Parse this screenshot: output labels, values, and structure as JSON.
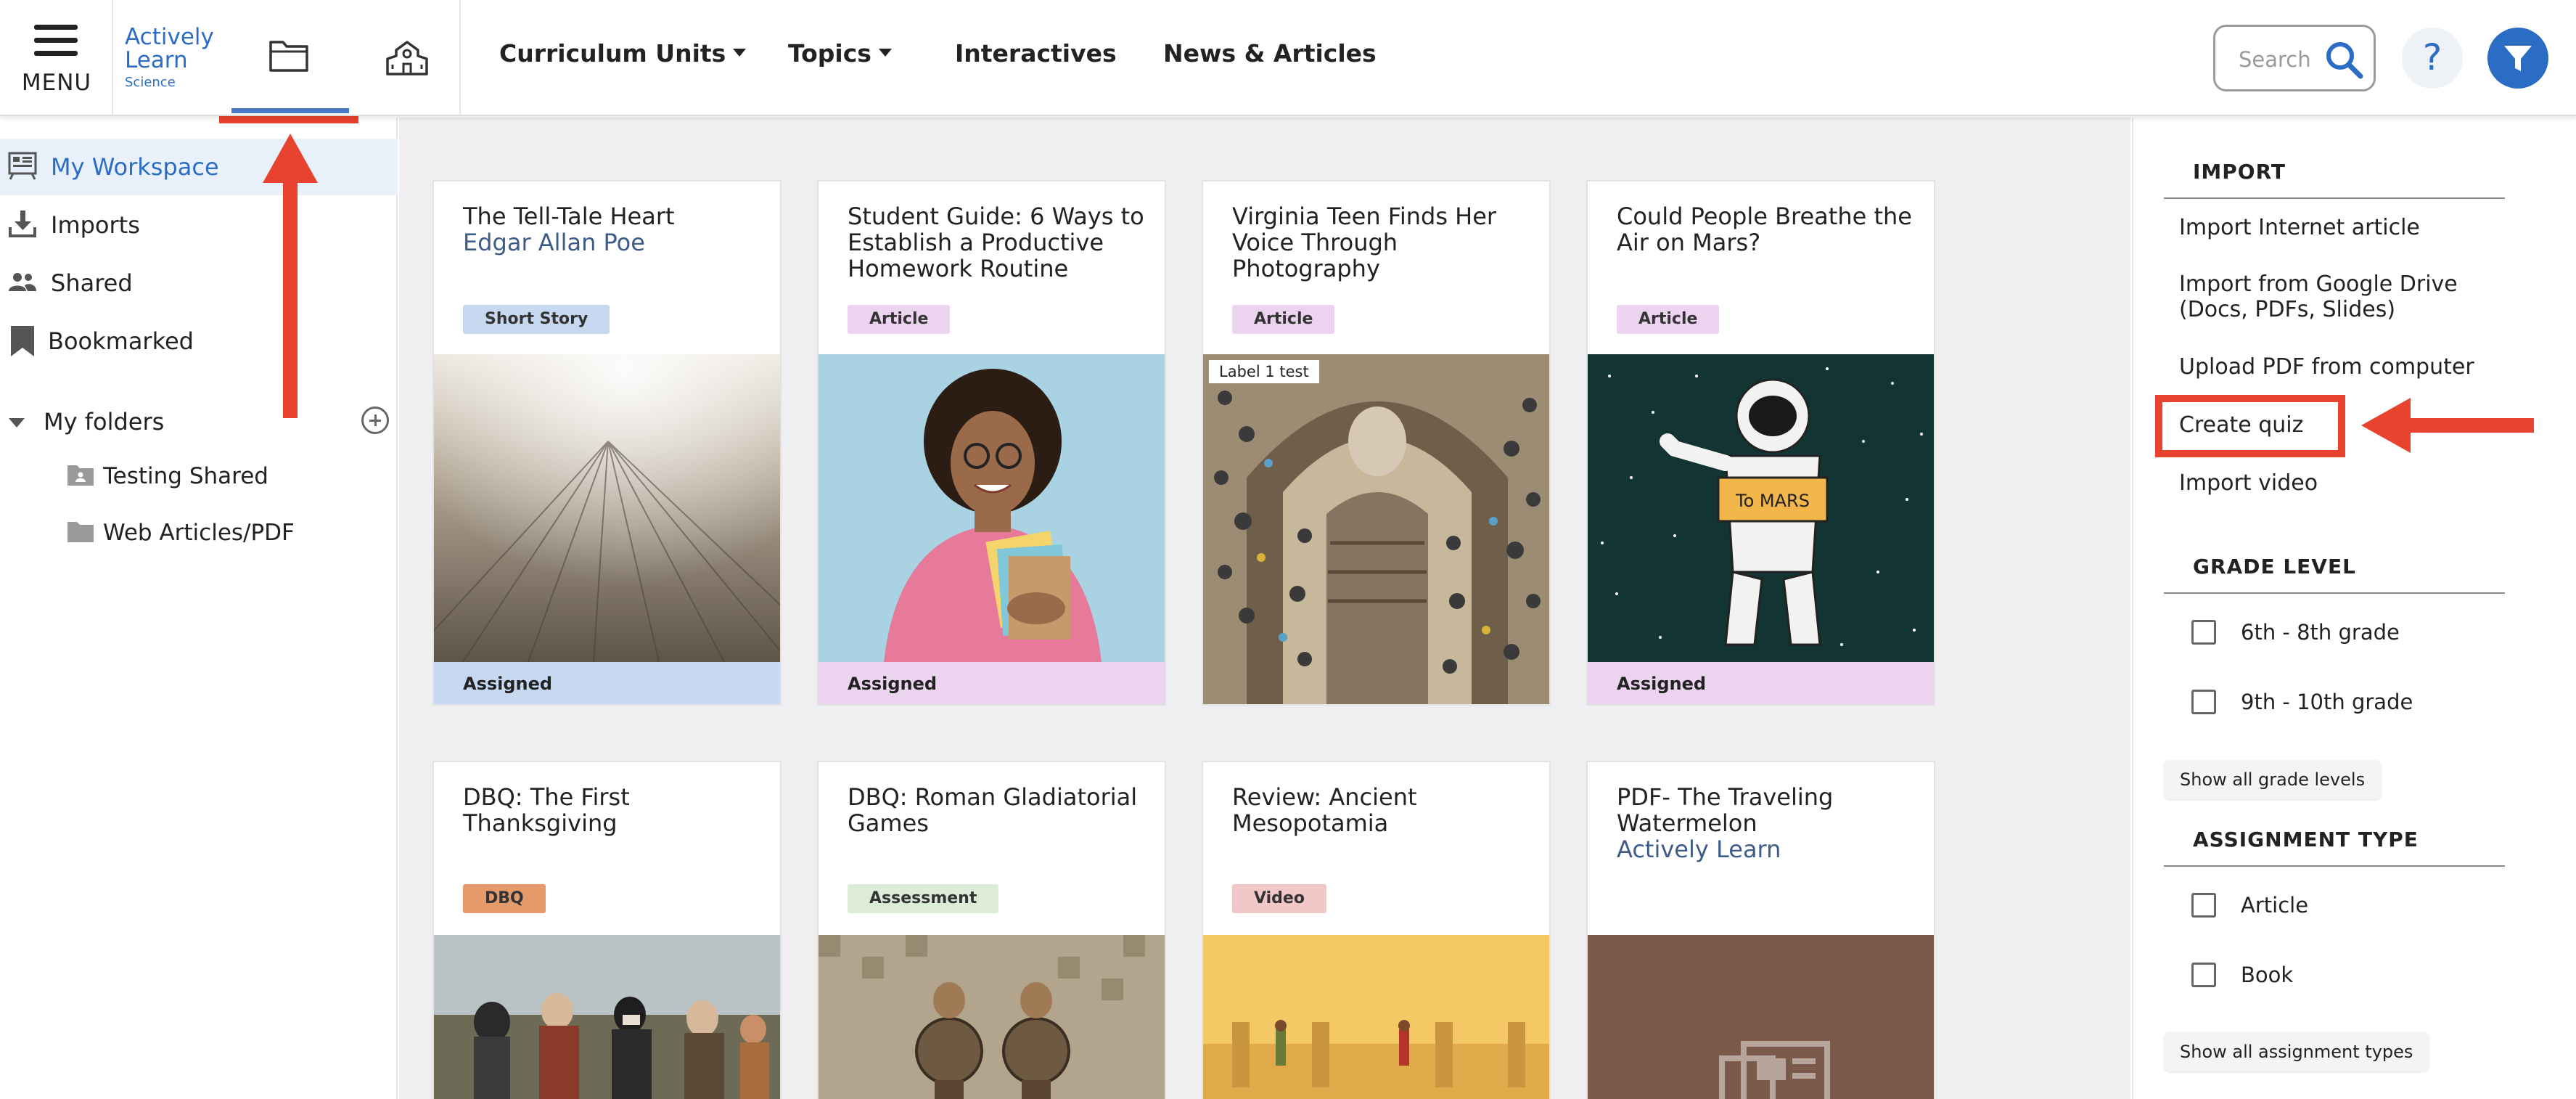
{
  "header": {
    "menu_label": "MENU",
    "logo": {
      "line1": "Actively",
      "line2": "Learn",
      "line3": "Science"
    },
    "nav": [
      {
        "label": "Curriculum Units"
      },
      {
        "label": "Topics"
      },
      {
        "label": "Interactives"
      },
      {
        "label": "News & Articles"
      }
    ],
    "search_placeholder": "Search",
    "help_label": "?"
  },
  "sidebar": {
    "items": [
      {
        "label": "My Workspace",
        "active": true
      },
      {
        "label": "Imports"
      },
      {
        "label": "Shared"
      },
      {
        "label": "Bookmarked"
      }
    ],
    "folders_label": "My folders",
    "folders": [
      {
        "label": "Testing Shared"
      },
      {
        "label": "Web Articles/PDF"
      }
    ]
  },
  "cards": [
    {
      "title": "The Tell-Tale Heart",
      "author": "Edgar Allan Poe",
      "tag": "Short Story",
      "status": "Assigned"
    },
    {
      "title": "Student Guide: 6 Ways to Establish a Productive Homework Routine",
      "author": "",
      "tag": "Article",
      "status": "Assigned"
    },
    {
      "title": "Virginia Teen Finds Her Voice Through Photography",
      "author": "",
      "tag": "Article",
      "status": "",
      "image_label": "Label 1 test"
    },
    {
      "title": "Could People Breathe the Air on Mars?",
      "author": "",
      "tag": "Article",
      "status": "Assigned",
      "image_text": "To MARS"
    },
    {
      "title": "DBQ: The First Thanksgiving",
      "author": "",
      "tag": "DBQ",
      "status": ""
    },
    {
      "title": "DBQ: Roman Gladiatorial Games",
      "author": "",
      "tag": "Assessment",
      "status": ""
    },
    {
      "title": "Review: Ancient Mesopotamia",
      "author": "",
      "tag": "Video",
      "status": ""
    },
    {
      "title": "PDF- The Traveling Watermelon",
      "author": "Actively Learn",
      "tag": "",
      "status": ""
    }
  ],
  "right_panel": {
    "import_heading": "IMPORT",
    "import_links": [
      "Import Internet article",
      "Import from Google Drive (Docs, PDFs, Slides)",
      "Upload PDF from computer",
      "Create quiz",
      "Import video"
    ],
    "grade_heading": "GRADE LEVEL",
    "grades": [
      "6th - 8th grade",
      "9th - 10th grade"
    ],
    "show_grades": "Show all grade levels",
    "assignment_heading": "ASSIGNMENT TYPE",
    "assignment_types": [
      "Article",
      "Book"
    ],
    "show_assignment_types": "Show all assignment types"
  },
  "colors": {
    "accent": "#2b6cc4",
    "annotation": "#e8432f",
    "tag_short_story": "#c6d9f1",
    "tag_article": "#ecd3ef",
    "tag_dbq": "#e49a6b",
    "tag_assessment": "#dcecd9",
    "tag_video": "#f2c7c7"
  }
}
